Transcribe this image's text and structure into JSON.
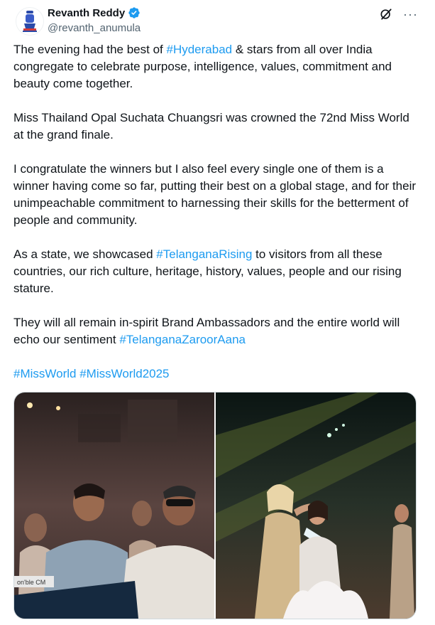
{
  "author": {
    "display_name": "Revanth Reddy",
    "handle": "@revanth_anumula",
    "verified": true,
    "avatar_icon": "emblem-icon"
  },
  "actions": {
    "grok_icon": "grok-icon",
    "more_icon": "more-icon",
    "more_label": "···"
  },
  "tweet": {
    "p1": {
      "a": "The evening had the best of ",
      "tag": "#Hyderabad",
      "b": " & stars from all over India congregate to celebrate purpose, intelligence, values, commitment and beauty come together."
    },
    "p2": "Miss Thailand Opal Suchata Chuangsri was crowned the 72nd Miss World at the grand finale.",
    "p3": "I congratulate the winners but I also feel every single one of them is a winner having come so far, putting their best on a global stage, and for their unimpeachable commitment to harnessing their skills for the betterment of people and community.",
    "p4": {
      "a": "As a state, we showcased ",
      "tag": "#TelanganaRising",
      "b": " to visitors from all these countries, our rich culture, heritage, history, values, people and our rising stature."
    },
    "p5": {
      "a": "They will all remain in-spirit Brand Ambassadors and the entire world will echo our sentiment ",
      "tag": "#TelanganaZaroorAana"
    },
    "p6": {
      "tag1": "#MissWorld",
      "sep": " ",
      "tag2": "#MissWorld2025"
    }
  },
  "media": {
    "photo1": {
      "placard_text": "on'ble CM"
    }
  },
  "colors": {
    "link": "#1d9bf0",
    "text": "#0f1419",
    "muted": "#536471",
    "verified": "#1d9bf0"
  }
}
